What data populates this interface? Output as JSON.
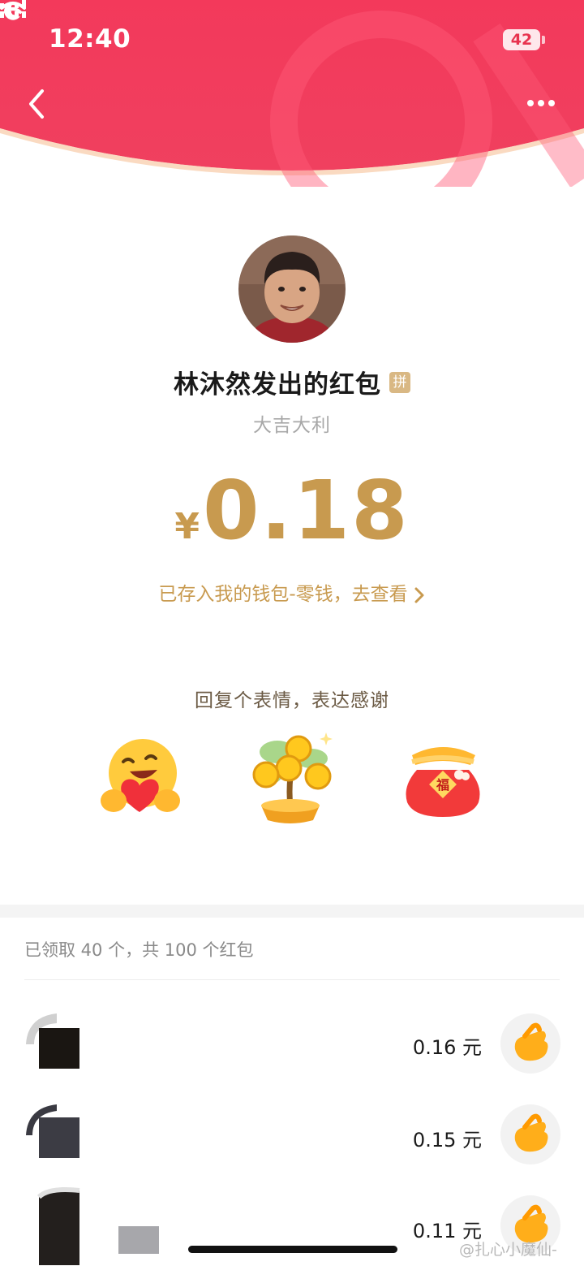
{
  "status_bar": {
    "time": "12:40",
    "battery": "42"
  },
  "colors": {
    "header_red": "#f2395a",
    "gold": "#c89a4f",
    "brown_text": "#6b5a44"
  },
  "icons": {
    "back": "chevron-left-icon",
    "more": "more-dots-icon",
    "moon": "moon-icon",
    "signal": "cellular-signal-icon",
    "wifi": "wifi-icon"
  },
  "envelope": {
    "sender_title": "林沐然发出的红包",
    "badge": "拼",
    "greeting": "大吉大利",
    "currency": "¥",
    "amount": "0.18",
    "wallet_link": "已存入我的钱包-零钱，去查看"
  },
  "reply": {
    "title": "回复个表情，表达感谢",
    "stickers": [
      "heart-hug-emoji",
      "money-tree-sticker",
      "lucky-bag-sticker"
    ],
    "lucky_bag_char": "福"
  },
  "summary": "已领取 40 个，共 100 个红包",
  "records": [
    {
      "amount": "0.16 元"
    },
    {
      "amount": "0.15 元"
    },
    {
      "amount": "0.11 元"
    }
  ],
  "watermark": "@扎心小魔仙-"
}
